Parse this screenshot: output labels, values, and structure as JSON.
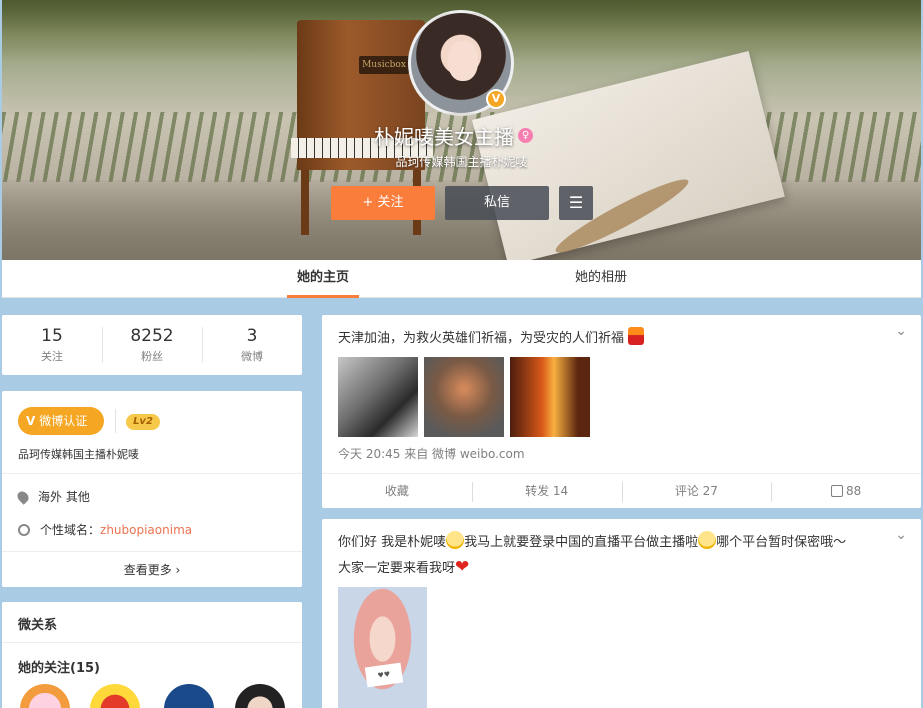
{
  "profile": {
    "name": "朴妮唛美女主播",
    "intro": "品珂传媒韩国主播朴妮唛",
    "piano_plate": "Musicbox",
    "follow_label": "+ 关注",
    "message_label": "私信",
    "menu_icon": "menu-icon"
  },
  "tabs": [
    {
      "label": "她的主页",
      "active": true
    },
    {
      "label": "她的相册",
      "active": false
    }
  ],
  "stats": [
    {
      "value": "15",
      "label": "关注"
    },
    {
      "value": "8252",
      "label": "粉丝"
    },
    {
      "value": "3",
      "label": "微博"
    }
  ],
  "info": {
    "verify_label": "微博认证",
    "level": "Lv2",
    "verify_desc": "品珂传媒韩国主播朴妮唛",
    "location": "海外 其他",
    "domain_label": "个性域名：",
    "domain_value": "zhubopiaonima",
    "more_label": "查看更多 ›"
  },
  "relations": {
    "title": "微关系",
    "following_title": "她的关注(15)"
  },
  "feed": [
    {
      "text": "天津加油，为救火英雄们祈福，为受灾的人们祈福",
      "meta": "今天 20:45 来自 微博 weibo.com",
      "actions": {
        "collect": "收藏",
        "repost": "转发 14",
        "comment": "评论 27",
        "like": "88"
      }
    },
    {
      "text_a": "你们好 我是朴妮唛",
      "text_b": "我马上就要登录中国的直播平台做主播啦",
      "text_c": "哪个平台暂时保密哦～",
      "text_d": "大家一定要来看我呀"
    }
  ],
  "colors": {
    "accent": "#fa7d3c",
    "verify": "#f5a623",
    "link": "#eb7350",
    "bg": "#a9cbe4"
  }
}
